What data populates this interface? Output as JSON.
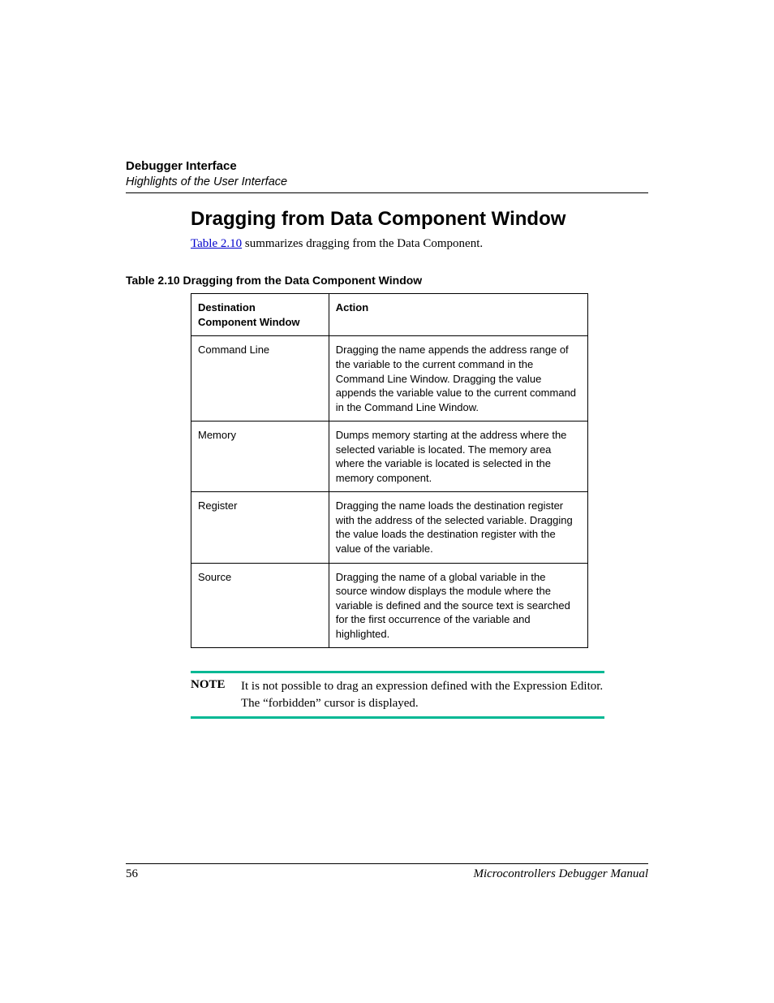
{
  "header": {
    "title": "Debugger Interface",
    "subtitle": "Highlights of the User Interface"
  },
  "section": {
    "heading": "Dragging from Data Component Window",
    "intro_link": "Table 2.10",
    "intro_rest": " summarizes dragging from the Data Component."
  },
  "table": {
    "caption": "Table 2.10  Dragging from the Data Component Window",
    "col1_header_l1": "Destination",
    "col1_header_l2": "Component Window",
    "col2_header": "Action",
    "rows": [
      {
        "dest": "Command Line",
        "action": "Dragging the name appends the address range of the variable to the current command in the Command Line Window. Dragging the value appends the variable value to the current command in the Command Line Window."
      },
      {
        "dest": "Memory",
        "action": "Dumps memory starting at the address where the selected variable is located. The memory area where the variable is located is selected in the memory component."
      },
      {
        "dest": "Register",
        "action": "Dragging the name loads the destination register with the address of the selected variable. Dragging the value loads the destination register with the value of the variable."
      },
      {
        "dest": "Source",
        "action": "Dragging the name of a global variable in the source window displays the module where the variable is defined and the source text is searched for the first occurrence of the variable and highlighted."
      }
    ]
  },
  "note": {
    "label": "NOTE",
    "text": "It is not possible to drag an expression defined with the Expression Editor. The “forbidden” cursor is displayed."
  },
  "footer": {
    "page": "56",
    "manual": "Microcontrollers Debugger Manual"
  }
}
